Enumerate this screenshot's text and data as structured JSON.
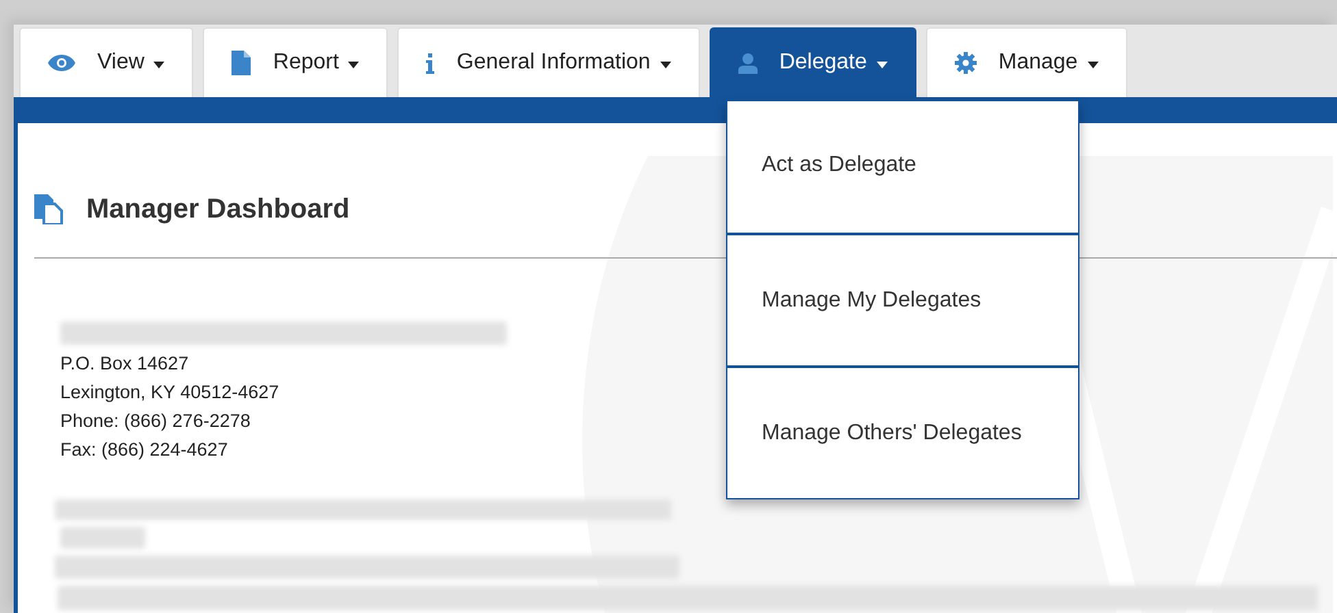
{
  "tabs": [
    {
      "label": "View",
      "kind": "eye",
      "selected": false
    },
    {
      "label": "Report",
      "kind": "file",
      "selected": false
    },
    {
      "label": "General Information",
      "kind": "info",
      "selected": false
    },
    {
      "label": "Delegate",
      "kind": "user",
      "selected": true
    },
    {
      "label": "Manage",
      "kind": "gear",
      "selected": false
    }
  ],
  "dropdown": {
    "items": [
      {
        "label": "Act as Delegate"
      },
      {
        "label": "Manage My Delegates"
      },
      {
        "label": "Manage Others' Delegates"
      }
    ]
  },
  "page": {
    "title": "Manager Dashboard"
  },
  "address": {
    "lines": [
      "P.O. Box 14627",
      "Lexington, KY 40512-4627",
      "Phone: (866) 276-2278",
      "Fax: (866) 224-4627"
    ]
  },
  "redactions": [
    {
      "kind": "address_name"
    },
    {
      "kind": "line"
    },
    {
      "kind": "short"
    },
    {
      "kind": "line"
    },
    {
      "kind": "wide"
    }
  ]
}
